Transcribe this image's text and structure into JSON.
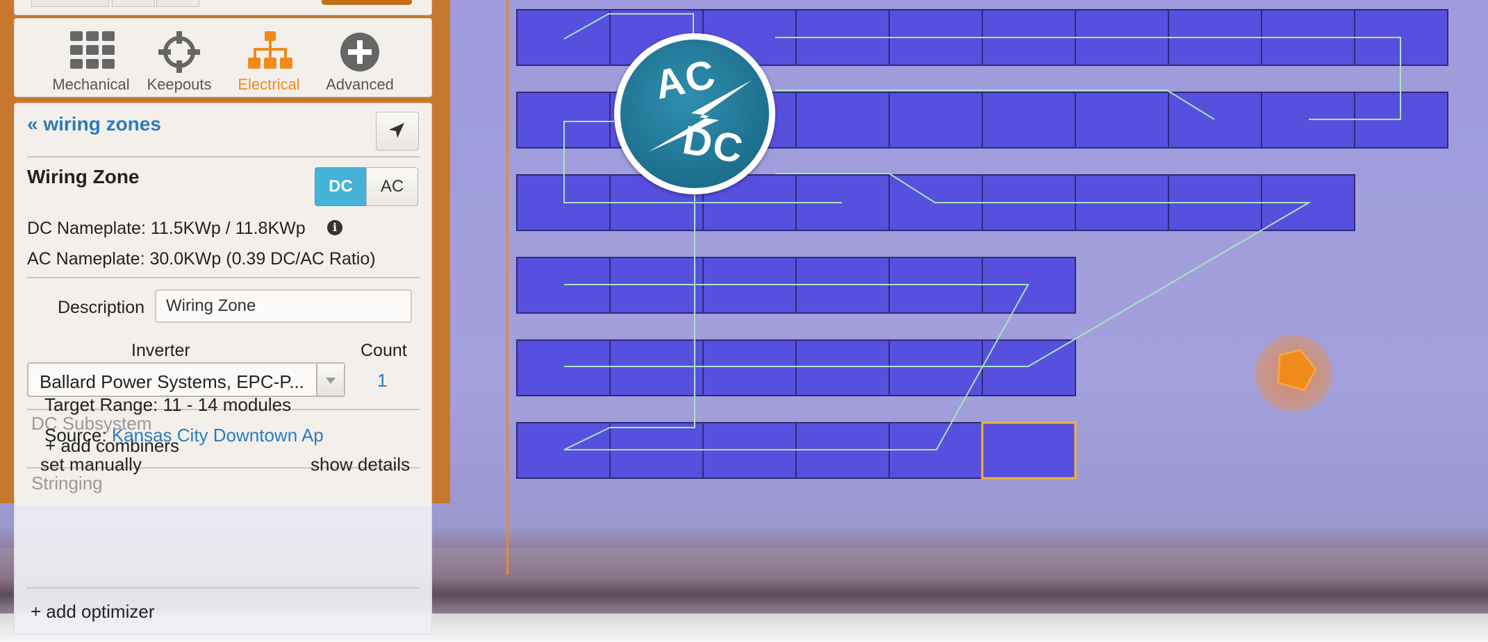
{
  "tools": [
    {
      "label": "Mechanical",
      "icon": "grid-icon",
      "active": false
    },
    {
      "label": "Keepouts",
      "icon": "crosshair-icon",
      "active": false
    },
    {
      "label": "Electrical",
      "icon": "network-icon",
      "active": true
    },
    {
      "label": "Advanced",
      "icon": "plus-circle-icon",
      "active": false
    }
  ],
  "panel": {
    "back_link": "« wiring zones",
    "zone_title": "Wiring Zone",
    "toggle": {
      "dc": "DC",
      "ac": "AC",
      "selected": "DC"
    },
    "dc_nameplate": "DC Nameplate: 11.5KWp / 11.8KWp",
    "ac_nameplate": "AC Nameplate: 30.0KWp (0.39 DC/AC Ratio)",
    "description_label": "Description",
    "description_value": "Wiring Zone",
    "inverter_label": "Inverter",
    "inverter_value": "Ballard Power Systems, EPC-P...",
    "count_label": "Count",
    "count_value": "1",
    "dc_subsystem": "DC Subsystem",
    "add_combiners": "+ add combiners",
    "stringing": "Stringing",
    "target_range": "Target Range: 11 - 14 modules",
    "source_label": "Source: ",
    "source_value": "Kansas City Downtown Ap",
    "set_manually": "set manually",
    "show_details": "show details",
    "add_optimizer": "+ add optimizer"
  },
  "badge": {
    "top": "AC",
    "bottom": "DC"
  },
  "colors": {
    "accent_orange": "#f08a1a",
    "link_blue": "#2b7bbd",
    "toggle_blue": "#45b3d8",
    "module_fill": "#5750de",
    "wire": "#9fe0c8"
  },
  "modules": {
    "rows": [
      10,
      10,
      9,
      6,
      6,
      6
    ],
    "highlighted": {
      "row": 5,
      "col": 5
    }
  }
}
